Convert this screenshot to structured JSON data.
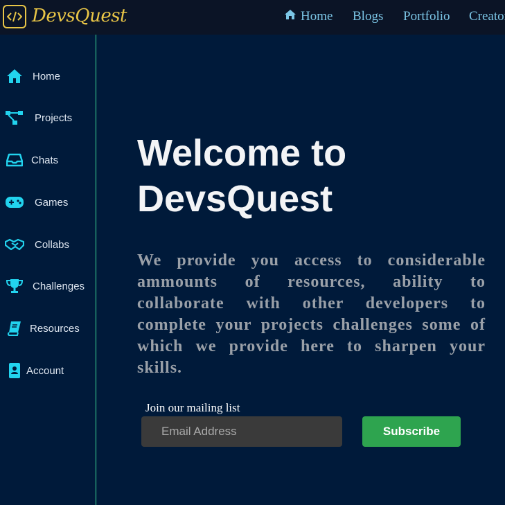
{
  "brand": {
    "name": "DevsQuest",
    "logo_icon": "code-icon",
    "accent": "#e8c547"
  },
  "nav": {
    "items": [
      {
        "label": "Home",
        "icon": "home-icon"
      },
      {
        "label": "Blogs"
      },
      {
        "label": "Portfolio"
      },
      {
        "label": "Creator"
      }
    ],
    "color": "#7cc6e6"
  },
  "sidebar": {
    "items": [
      {
        "label": "Home",
        "icon": "home-icon"
      },
      {
        "label": "Projects",
        "icon": "project-diagram-icon"
      },
      {
        "label": "Chats",
        "icon": "inbox-icon"
      },
      {
        "label": "Games",
        "icon": "gamepad-icon"
      },
      {
        "label": "Collabs",
        "icon": "handshake-icon"
      },
      {
        "label": "Challenges",
        "icon": "trophy-icon"
      },
      {
        "label": "Resources",
        "icon": "book-icon"
      },
      {
        "label": "Account",
        "icon": "contact-book-icon"
      }
    ],
    "icon_color": "#22d3ee",
    "border_color": "#3ddc97"
  },
  "hero": {
    "title_line1": "Welcome to",
    "title_line2": "DevsQuest",
    "description": "We provide you access to considerable ammounts of resources, ability to collaborate with other developers to complete your projects challenges some of which we provide here to sharpen your skills."
  },
  "mailing": {
    "label": "Join our mailing list",
    "email_placeholder": "Email Address",
    "subscribe_label": "Subscribe",
    "button_color": "#2ea44f"
  }
}
